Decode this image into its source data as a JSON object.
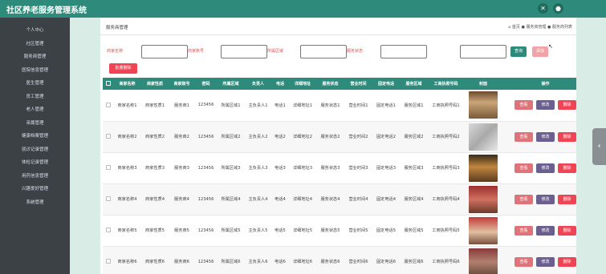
{
  "app": {
    "title": "社区养老服务管理系统"
  },
  "header": {
    "icon_left": "settings-icon",
    "icon_right": "user-icon"
  },
  "sidebar": {
    "items": [
      {
        "label": "个人中心"
      },
      {
        "label": "社区管理"
      },
      {
        "label": "服务商管理"
      },
      {
        "label": "医院信息管理"
      },
      {
        "label": "医生管理"
      },
      {
        "label": "员工管理"
      },
      {
        "label": "老人管理"
      },
      {
        "label": "亲属管理"
      },
      {
        "label": "健康档案管理"
      },
      {
        "label": "就诊记录管理"
      },
      {
        "label": "体检记录管理"
      },
      {
        "label": "用药信息管理"
      },
      {
        "label": "兴趣爱好管理"
      },
      {
        "label": "系统管理"
      }
    ]
  },
  "breadcrumb": {
    "title": "服务商管理",
    "path": "⌂ 首页 ● 服务商管理 ● 服务商列表"
  },
  "filters": {
    "name_label": "商家名称",
    "account_label": "商家账号",
    "region_label": "所属区域",
    "status_label": "服务状态",
    "search_button": "查询",
    "add_button": "添加",
    "delete_button": "批量删除"
  },
  "table": {
    "headers": [
      "",
      "商家名称",
      "商家性质",
      "商家账号",
      "密码",
      "所属区域",
      "负责人",
      "电话",
      "详细地址",
      "服务状态",
      "营业时间",
      "固定电话",
      "服务区域",
      "工商执照号码",
      "封面",
      "操作"
    ],
    "actions": {
      "view": "查看",
      "edit": "修改",
      "delete": "删除"
    },
    "rows": [
      [
        "商家名称1",
        "商家性质1",
        "服务商1",
        "123456",
        "所属区域1",
        "主负责人1",
        "电话1",
        "详细地址1",
        "服务状态1",
        "营业时间1",
        "固定电话1",
        "服务区域1",
        "工商执照号码1"
      ],
      [
        "商家名称2",
        "商家性质2",
        "服务商2",
        "123456",
        "所属区域2",
        "主负责人2",
        "电话2",
        "详细地址2",
        "服务状态2",
        "营业时间2",
        "固定电话2",
        "服务区域2",
        "工商执照号码2"
      ],
      [
        "商家名称3",
        "商家性质3",
        "服务商3",
        "123456",
        "所属区域3",
        "主负责人3",
        "电话3",
        "详细地址3",
        "服务状态3",
        "营业时间3",
        "固定电话3",
        "服务区域3",
        "工商执照号码3"
      ],
      [
        "商家名称4",
        "商家性质4",
        "服务商4",
        "123456",
        "所属区域4",
        "主负责人4",
        "电话4",
        "详细地址4",
        "服务状态4",
        "营业时间4",
        "固定电话4",
        "服务区域4",
        "工商执照号码4"
      ],
      [
        "商家名称5",
        "商家性质5",
        "服务商5",
        "123456",
        "所属区域5",
        "主负责人5",
        "电话5",
        "详细地址5",
        "服务状态5",
        "营业时间5",
        "固定电话5",
        "服务区域5",
        "工商执照号码5"
      ],
      [
        "商家名称6",
        "商家性质6",
        "服务商6",
        "123456",
        "所属区域6",
        "主负责人6",
        "电话6",
        "详细地址6",
        "服务状态6",
        "营业时间6",
        "固定电话6",
        "服务区域6",
        "工商执照号码6"
      ]
    ]
  },
  "side_tab": {
    "icon": "chevron-left-icon"
  }
}
